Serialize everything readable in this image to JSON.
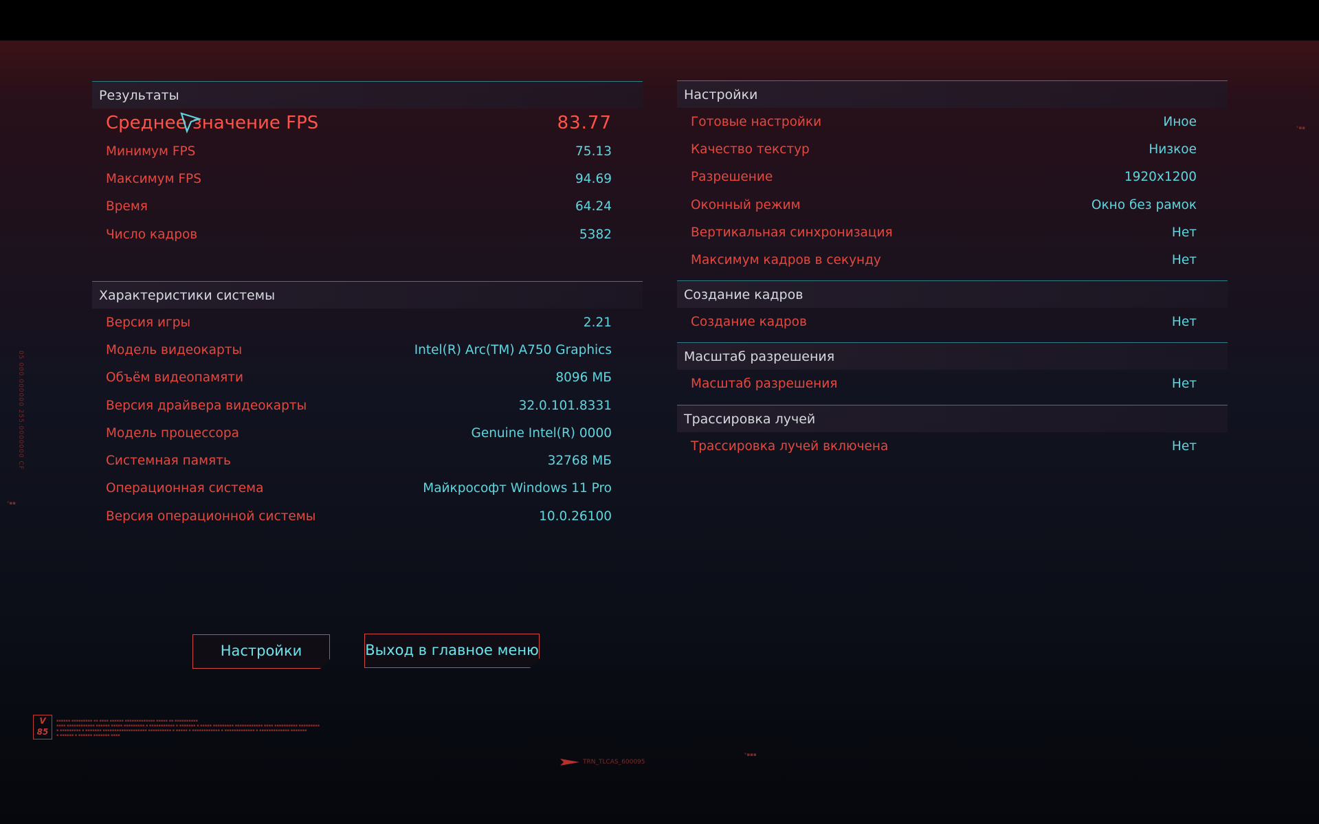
{
  "results": {
    "title": "Результаты",
    "avg_fps": {
      "label": "Среднее значение FPS",
      "value": "83.77"
    },
    "rows": [
      {
        "label": "Минимум FPS",
        "value": "75.13"
      },
      {
        "label": "Максимум FPS",
        "value": "94.69"
      },
      {
        "label": "Время",
        "value": "64.24"
      },
      {
        "label": "Число кадров",
        "value": "5382"
      }
    ]
  },
  "system": {
    "title": "Характеристики системы",
    "rows": [
      {
        "label": "Версия игры",
        "value": "2.21"
      },
      {
        "label": "Модель видеокарты",
        "value": "Intel(R) Arc(TM) A750 Graphics"
      },
      {
        "label": "Объём видеопамяти",
        "value": "8096 МБ"
      },
      {
        "label": "Версия драйвера видеокарты",
        "value": "32.0.101.8331"
      },
      {
        "label": "Модель процессора",
        "value": "Genuine Intel(R) 0000"
      },
      {
        "label": "Системная память",
        "value": "32768 МБ"
      },
      {
        "label": "Операционная система",
        "value": "Майкрософт Windows 11 Pro"
      },
      {
        "label": "Версия операционной системы",
        "value": "10.0.26100"
      }
    ]
  },
  "settings": {
    "title": "Настройки",
    "rows": [
      {
        "label": "Готовые настройки",
        "value": "Иное"
      },
      {
        "label": "Качество текстур",
        "value": "Низкое"
      },
      {
        "label": "Разрешение",
        "value": "1920x1200"
      },
      {
        "label": "Оконный режим",
        "value": "Окно без рамок"
      },
      {
        "label": "Вертикальная синхронизация",
        "value": "Нет"
      },
      {
        "label": "Максимум кадров в секунду",
        "value": "Нет"
      }
    ]
  },
  "frame_gen": {
    "title": "Создание кадров",
    "rows": [
      {
        "label": "Создание кадров",
        "value": "Нет"
      }
    ]
  },
  "res_scale": {
    "title": "Масштаб разрешения",
    "rows": [
      {
        "label": "Масштаб разрешения",
        "value": "Нет"
      }
    ]
  },
  "raytracing": {
    "title": "Трассировка лучей",
    "rows": [
      {
        "label": "Трассировка лучей включена",
        "value": "Нет"
      }
    ]
  },
  "buttons": {
    "settings": "Настройки",
    "exit": "Выход в главное меню"
  },
  "decor": {
    "logo": "V 85",
    "code": "TRN_TLCAS_600095"
  },
  "colors": {
    "label_red": "#e5483f",
    "value_cyan": "#5fd6df",
    "header_line": "#2f7d86"
  }
}
